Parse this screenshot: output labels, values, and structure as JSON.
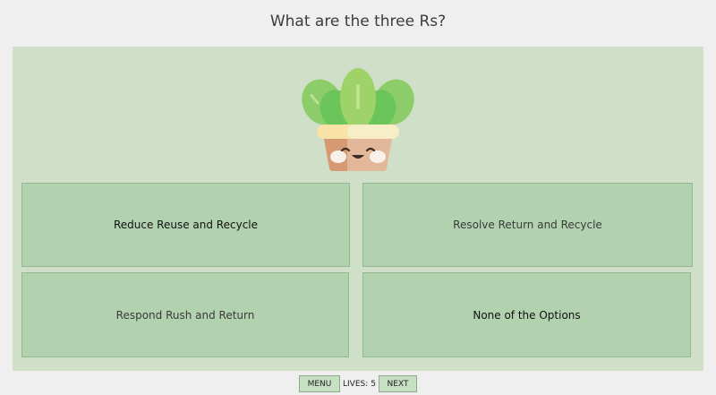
{
  "question": "What are the three Rs?",
  "mascot": {
    "icon": "potted-plant-icon"
  },
  "answers": [
    {
      "label": "Reduce Reuse and Recycle"
    },
    {
      "label": "Resolve Return and Recycle"
    },
    {
      "label": "Respond Rush and Return"
    },
    {
      "label": "None of the Options"
    }
  ],
  "footer": {
    "menu_label": "MENU",
    "lives_label": "LIVES:",
    "lives_value": "5",
    "next_label": "NEXT"
  },
  "colors": {
    "page_bg": "#efefef",
    "panel_bg": "#d0e0c8",
    "answer_bg": "#b2d1ae",
    "button_bg": "#c7dfc3"
  }
}
